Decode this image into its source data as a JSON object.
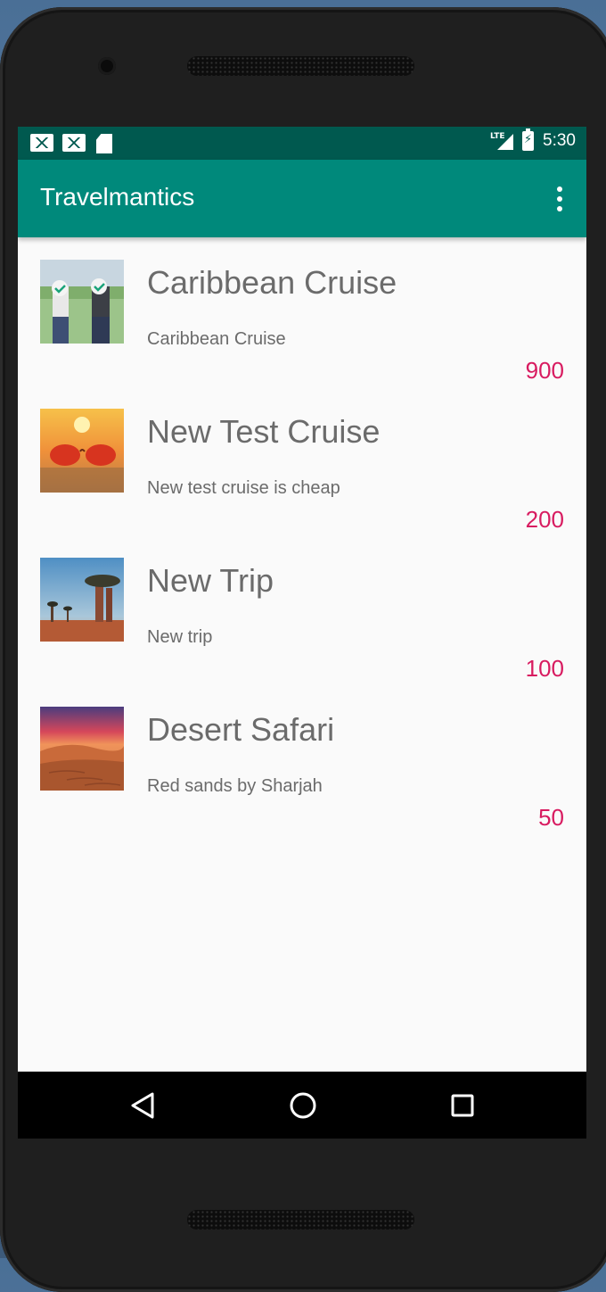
{
  "statusbar": {
    "time": "5:30",
    "network": "LTE",
    "icons": [
      "mail-icon",
      "mail-icon",
      "sd-card-icon",
      "signal-icon",
      "battery-charging-icon"
    ]
  },
  "appbar": {
    "title": "Travelmantics",
    "menu_icon": "overflow-menu-icon",
    "color": "#00897b"
  },
  "deals": [
    {
      "title": "Caribbean Cruise",
      "description": "Caribbean Cruise",
      "price": "900",
      "image": "people-holding-signs"
    },
    {
      "title": "New Test Cruise",
      "description": "New test cruise is cheap",
      "price": "200",
      "image": "sunglasses-sunset"
    },
    {
      "title": "New Trip",
      "description": "New trip",
      "price": "100",
      "image": "baobab-trees"
    },
    {
      "title": "Desert Safari",
      "description": "Red sands by Sharjah",
      "price": "50",
      "image": "desert-dunes"
    }
  ],
  "colors": {
    "status_bar": "#00594f",
    "price": "#d81b60",
    "text": "#6b6b6b"
  },
  "navbar": {
    "icons": [
      "back-icon",
      "home-icon",
      "recent-apps-icon"
    ]
  }
}
